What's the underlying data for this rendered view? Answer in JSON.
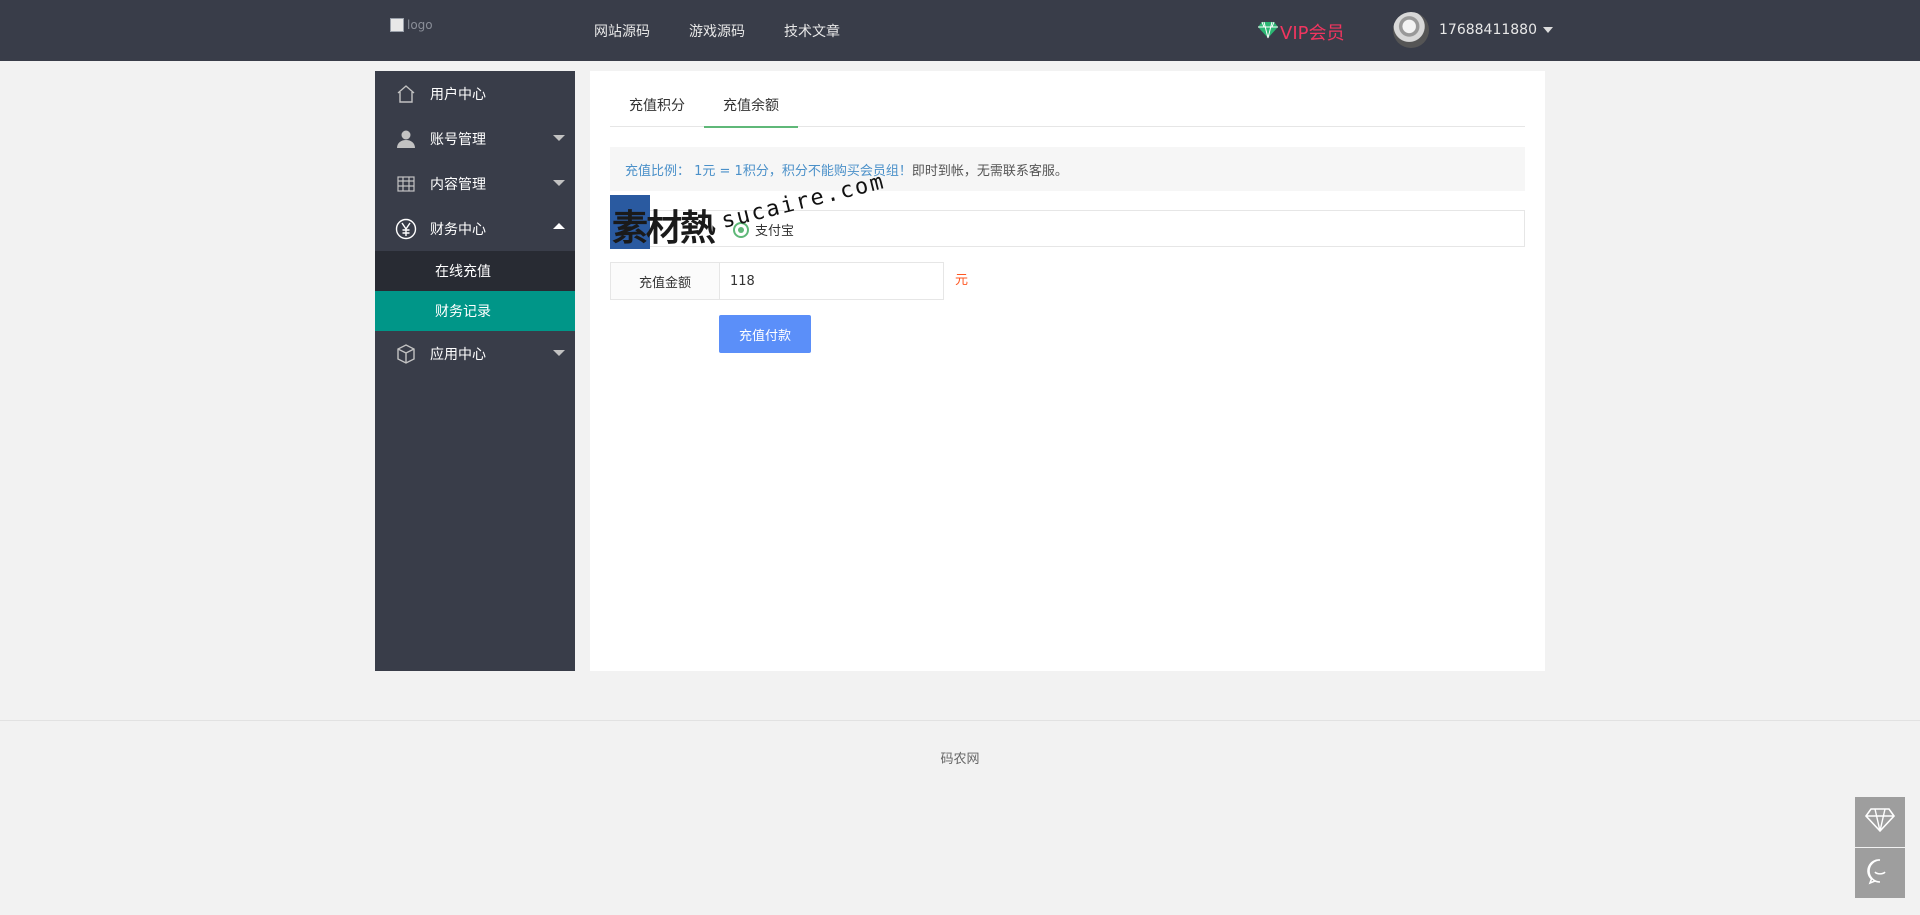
{
  "header": {
    "logo_alt": "logo",
    "nav": [
      "网站源码",
      "游戏源码",
      "技术文章"
    ],
    "vip_label": "VIP会员",
    "username": "17688411880"
  },
  "sidebar": {
    "items": [
      {
        "label": "用户中心",
        "icon": "home-icon"
      },
      {
        "label": "账号管理",
        "icon": "user-icon"
      },
      {
        "label": "内容管理",
        "icon": "grid-icon"
      },
      {
        "label": "财务中心",
        "icon": "yen-icon",
        "expanded": true,
        "children": [
          {
            "label": "在线充值"
          },
          {
            "label": "财务记录",
            "active": true
          }
        ]
      },
      {
        "label": "应用中心",
        "icon": "cube-icon"
      }
    ]
  },
  "main": {
    "tabs": [
      {
        "label": "充值积分"
      },
      {
        "label": "充值余额",
        "active": true
      }
    ],
    "notice_highlight": "充值比例： 1元 = 1积分，积分不能购买会员组！",
    "notice_rest": " 即时到帐，无需联系客服。",
    "method_label": "支付宝",
    "amount_label": "充值金额",
    "amount_value": "118",
    "amount_unit": "元",
    "pay_button": "充值付款"
  },
  "watermark": {
    "cn": "素材熱",
    "en": "sucaire.com"
  },
  "footer": {
    "text": "码农网"
  },
  "float_tools": {
    "top_icon": "diamond-icon",
    "bottom_icon": "chat-icon"
  },
  "colors": {
    "header_bg": "#393d49",
    "active_green": "#009688",
    "tab_underline": "#5fb878",
    "vip_red": "#f0355f",
    "pay_blue": "#5b8ff9",
    "unit_orange": "#ff5722"
  }
}
